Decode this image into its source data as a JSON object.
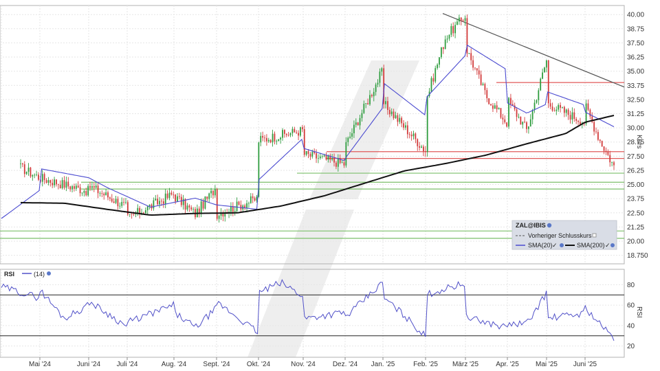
{
  "chart_data": [
    {
      "type": "candlestick",
      "ticker": "ZAL@IBIS",
      "ylabel": "Kurs",
      "ylim": [
        18.0,
        40.8
      ],
      "y_ticks": [
        "40.00",
        "38.75",
        "37.50",
        "36.25",
        "35.00",
        "33.75",
        "32.50",
        "31.25",
        "30.00",
        "28.75",
        "27.50",
        "26.25",
        "25.00",
        "23.75",
        "22.50",
        "21.25",
        "20.00",
        "18.750"
      ],
      "x_ticks": [
        "Mai '24",
        "Juni '24",
        "Juli '24",
        "Aug. '24",
        "Sept. '24",
        "Okt. '24",
        "Nov. '24",
        "Dez. '24",
        "Jan. '25",
        "Feb. '25",
        "März '25",
        "Apr. '25",
        "Mai '25",
        "Juni '25"
      ],
      "grid": true,
      "up_color": "#2e9c3e",
      "down_color": "#d23a3a",
      "close_anchors": [
        {
          "x": "Apr. '24",
          "y": 26.5
        },
        {
          "x": "Mai '24",
          "y": 25.6
        },
        {
          "x": "Mai '24",
          "y": 24.4
        },
        {
          "x": "Juni '24",
          "y": 24.9
        },
        {
          "x": "Juni '24",
          "y": 23.0
        },
        {
          "x": "Juli '24",
          "y": 22.0
        },
        {
          "x": "Juli '24",
          "y": 24.2
        },
        {
          "x": "Aug. '24",
          "y": 24.0
        },
        {
          "x": "Aug. '24",
          "y": 22.4
        },
        {
          "x": "Aug. '24",
          "y": 24.8
        },
        {
          "x": "Sept. '24",
          "y": 22.4
        },
        {
          "x": "Sept. '24",
          "y": 23.8
        },
        {
          "x": "Okt. '24",
          "y": 28.9
        },
        {
          "x": "Okt. '24",
          "y": 29.8
        },
        {
          "x": "Nov. '24",
          "y": 27.7
        },
        {
          "x": "Nov. '24",
          "y": 26.8
        },
        {
          "x": "Dez. '24",
          "y": 28.4
        },
        {
          "x": "Dez. '24",
          "y": 35.1
        },
        {
          "x": "Jan. '25",
          "y": 32.2
        },
        {
          "x": "Jan. '25",
          "y": 28.0
        },
        {
          "x": "Feb. '25",
          "y": 32.3
        },
        {
          "x": "Feb. '25",
          "y": 38.0
        },
        {
          "x": "Feb. '25",
          "y": 39.9
        },
        {
          "x": "März '25",
          "y": 37.2
        },
        {
          "x": "März '25",
          "y": 32.8
        },
        {
          "x": "März '25",
          "y": 30.4
        },
        {
          "x": "Apr. '25",
          "y": 32.5
        },
        {
          "x": "Apr. '25",
          "y": 29.8
        },
        {
          "x": "Apr. '25",
          "y": 36.0
        },
        {
          "x": "Mai '25",
          "y": 32.2
        },
        {
          "x": "Mai '25",
          "y": 30.5
        },
        {
          "x": "Juni '25",
          "y": 32.0
        },
        {
          "x": "Juni '25",
          "y": 29.0
        },
        {
          "x": "Juni '25",
          "y": 26.6
        }
      ],
      "sma20_anchors": [
        {
          "x": "Apr. '24",
          "y": 22.0
        },
        {
          "x": "Apr. '24",
          "y": 24.5
        },
        {
          "x": "Mai '24",
          "y": 26.4
        },
        {
          "x": "Mai '24",
          "y": 25.6
        },
        {
          "x": "Juni '24",
          "y": 24.7
        },
        {
          "x": "Juli '24",
          "y": 23.0
        },
        {
          "x": "Aug. '24",
          "y": 23.8
        },
        {
          "x": "Sept. '24",
          "y": 23.2
        },
        {
          "x": "Sept. '24",
          "y": 22.8
        },
        {
          "x": "Okt. '24",
          "y": 25.4
        },
        {
          "x": "Okt. '24",
          "y": 29.1
        },
        {
          "x": "Nov. '24",
          "y": 28.2
        },
        {
          "x": "Nov. '24",
          "y": 27.1
        },
        {
          "x": "Dez. '24",
          "y": 27.3
        },
        {
          "x": "Dez. '24",
          "y": 31.8
        },
        {
          "x": "Jan. '25",
          "y": 34.0
        },
        {
          "x": "Jan. '25",
          "y": 31.1
        },
        {
          "x": "Feb. '25",
          "y": 32.6
        },
        {
          "x": "Feb. '25",
          "y": 36.4
        },
        {
          "x": "März '25",
          "y": 37.4
        },
        {
          "x": "März '25",
          "y": 35.1
        },
        {
          "x": "Apr. '25",
          "y": 32.2
        },
        {
          "x": "Apr. '25",
          "y": 31.3
        },
        {
          "x": "Apr. '25",
          "y": 32.1
        },
        {
          "x": "Mai '25",
          "y": 33.2
        },
        {
          "x": "Mai '25",
          "y": 32.0
        },
        {
          "x": "Juni '25",
          "y": 31.4
        },
        {
          "x": "Juni '25",
          "y": 30.1
        }
      ],
      "sma200_anchors": [
        {
          "x": "Apr. '24",
          "y": 23.4
        },
        {
          "x": "Mai '24",
          "y": 23.35
        },
        {
          "x": "Juni '24",
          "y": 22.8
        },
        {
          "x": "Juli '24",
          "y": 22.3
        },
        {
          "x": "Aug. '24",
          "y": 22.45
        },
        {
          "x": "Sept. '24",
          "y": 22.5
        },
        {
          "x": "Okt. '24",
          "y": 23.1
        },
        {
          "x": "Nov. '24",
          "y": 24.0
        },
        {
          "x": "Dez. '24",
          "y": 25.1
        },
        {
          "x": "Jan. '25",
          "y": 26.2
        },
        {
          "x": "Feb. '25",
          "y": 26.85
        },
        {
          "x": "März '25",
          "y": 27.6
        },
        {
          "x": "Apr. '25",
          "y": 28.6
        },
        {
          "x": "Mai '25",
          "y": 29.5
        },
        {
          "x": "Juni '25",
          "y": 30.5
        },
        {
          "x": "Juni '25",
          "y": 31.1
        }
      ],
      "horizontal_lines": [
        {
          "y": 34.0,
          "color": "#e05a5a"
        },
        {
          "y": 27.9,
          "color": "#e05a5a"
        },
        {
          "y": 27.3,
          "color": "#e05a5a"
        },
        {
          "y": 26.0,
          "color": "#7bbf6a"
        },
        {
          "y": 25.2,
          "color": "#7bbf6a"
        },
        {
          "y": 24.6,
          "color": "#7bbf6a"
        },
        {
          "y": 20.9,
          "color": "#7bbf6a"
        },
        {
          "y": 20.25,
          "color": "#7bbf6a"
        }
      ],
      "trendline": {
        "from": {
          "x": "Feb. '25",
          "y": 40.1
        },
        "to": {
          "x": "Juni '25",
          "y": 33.6
        }
      },
      "legend": {
        "title": "ZAL@IBIS",
        "entries": [
          {
            "name": "Vorheriger Schlusskurs",
            "color": "#555555",
            "style": "dashed"
          },
          {
            "name": "SMA(20)",
            "color": "#4a4ad0"
          },
          {
            "name": "SMA(200)",
            "color": "#111111"
          }
        ],
        "placement": "bottom-right"
      },
      "colors": {
        "sma20": "#4a4ad0",
        "sma200": "#111111",
        "trendline": "#555555"
      }
    },
    {
      "type": "line",
      "name": "RSI",
      "label": "RSI",
      "param": "(14)",
      "ylabel": "RSI",
      "ylim": [
        9,
        95
      ],
      "y_ticks": [
        "80",
        "60",
        "40",
        "20"
      ],
      "hlines": [
        70,
        30
      ],
      "color": "#5050c8",
      "anchors": [
        {
          "x": "Apr. '24",
          "y": 78
        },
        {
          "x": "Apr. '24",
          "y": 67
        },
        {
          "x": "Mai '24",
          "y": 75
        },
        {
          "x": "Mai '24",
          "y": 47
        },
        {
          "x": "Mai '24",
          "y": 60
        },
        {
          "x": "Juni '24",
          "y": 64
        },
        {
          "x": "Juni '24",
          "y": 39
        },
        {
          "x": "Juli '24",
          "y": 43
        },
        {
          "x": "Juli '24",
          "y": 60
        },
        {
          "x": "Aug. '24",
          "y": 53
        },
        {
          "x": "Aug. '24",
          "y": 38
        },
        {
          "x": "Aug. '24",
          "y": 57
        },
        {
          "x": "Sept. '24",
          "y": 63
        },
        {
          "x": "Sept. '24",
          "y": 33
        },
        {
          "x": "Okt. '24",
          "y": 72
        },
        {
          "x": "Okt. '24",
          "y": 82
        },
        {
          "x": "Okt. '24",
          "y": 69
        },
        {
          "x": "Nov. '24",
          "y": 47
        },
        {
          "x": "Nov. '24",
          "y": 53
        },
        {
          "x": "Dez. '24",
          "y": 48
        },
        {
          "x": "Dez. '24",
          "y": 82
        },
        {
          "x": "Jan. '25",
          "y": 68
        },
        {
          "x": "Jan. '25",
          "y": 50
        },
        {
          "x": "Jan. '25",
          "y": 29
        },
        {
          "x": "Feb. '25",
          "y": 70
        },
        {
          "x": "Feb. '25",
          "y": 82
        },
        {
          "x": "März '25",
          "y": 48
        },
        {
          "x": "März '25",
          "y": 38
        },
        {
          "x": "Apr. '25",
          "y": 41
        },
        {
          "x": "Apr. '25",
          "y": 42
        },
        {
          "x": "Apr. '25",
          "y": 72
        },
        {
          "x": "Mai '25",
          "y": 47
        },
        {
          "x": "Mai '25",
          "y": 52
        },
        {
          "x": "Juni '25",
          "y": 58
        },
        {
          "x": "Juni '25",
          "y": 42
        },
        {
          "x": "Juni '25",
          "y": 27
        }
      ]
    }
  ]
}
